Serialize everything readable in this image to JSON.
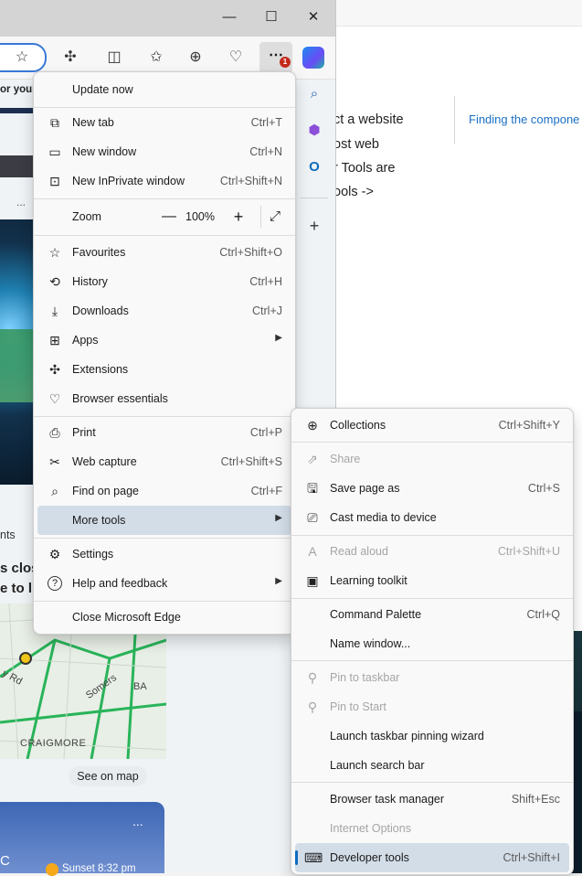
{
  "right_window": {
    "page_lines": [
      "ct a website",
      "ost web",
      "r Tools are",
      "ools ->"
    ],
    "link": "Finding the compone"
  },
  "left_window": {
    "controls": {
      "minimize": "—",
      "maximize": "☐",
      "close": "✕"
    },
    "toolbar_icons": [
      "star-icon",
      "extensions-icon",
      "split-screen-icon",
      "favorites-icon",
      "collections-icon",
      "browser-essentials-icon",
      "more-icon",
      "copilot-icon"
    ],
    "badge": "1"
  },
  "page_bg": {
    "cut_text": "or your",
    "dots": "...",
    "ents": "nts",
    "heading_lines": [
      "s clos",
      "e to l"
    ],
    "map_labels": [
      "y Rd",
      "Somers",
      "BA",
      "CRAIGMORE"
    ],
    "see_on_map": "See on map",
    "weather_temp": "C",
    "weather_more": "...",
    "sunset": "Sunset 8:32 pm"
  },
  "edge_sidebar": {
    "icons": [
      "search-icon",
      "copilot-icon",
      "outlook-icon",
      "add-icon"
    ]
  },
  "menu": {
    "update": "Update now",
    "items": [
      {
        "label": "New tab",
        "shortcut": "Ctrl+T",
        "icon": "⧉"
      },
      {
        "label": "New window",
        "shortcut": "Ctrl+N",
        "icon": "▭"
      },
      {
        "label": "New InPrivate window",
        "shortcut": "Ctrl+Shift+N",
        "icon": "⊡"
      }
    ],
    "zoom": {
      "label": "Zoom",
      "value": "100%",
      "minus": "—",
      "plus": "+",
      "full": "⤢"
    },
    "items2": [
      {
        "label": "Favourites",
        "shortcut": "Ctrl+Shift+O",
        "icon": "☆"
      },
      {
        "label": "History",
        "shortcut": "Ctrl+H",
        "icon": "⟲"
      },
      {
        "label": "Downloads",
        "shortcut": "Ctrl+J",
        "icon": "⤓"
      },
      {
        "label": "Apps",
        "shortcut": "",
        "icon": "⊞"
      },
      {
        "label": "Extensions",
        "shortcut": "",
        "icon": "✣"
      },
      {
        "label": "Browser essentials",
        "shortcut": "",
        "icon": "♡"
      }
    ],
    "items3": [
      {
        "label": "Print",
        "shortcut": "Ctrl+P",
        "icon": "⎙"
      },
      {
        "label": "Web capture",
        "shortcut": "Ctrl+Shift+S",
        "icon": "✂"
      },
      {
        "label": "Find on page",
        "shortcut": "Ctrl+F",
        "icon": "⌕"
      },
      {
        "label": "More tools",
        "shortcut": "",
        "icon": ""
      }
    ],
    "items4": [
      {
        "label": "Settings",
        "shortcut": "",
        "icon": "⚙"
      },
      {
        "label": "Help and feedback",
        "shortcut": "",
        "icon": "?"
      }
    ],
    "close": "Close Microsoft Edge"
  },
  "submenu": {
    "groups": [
      [
        {
          "label": "Collections",
          "shortcut": "Ctrl+Shift+Y",
          "icon": "⊕",
          "disabled": false
        },
        {
          "label": "Share",
          "shortcut": "",
          "icon": "⇗",
          "disabled": true
        },
        {
          "label": "Save page as",
          "shortcut": "Ctrl+S",
          "icon": "🖫",
          "disabled": false
        },
        {
          "label": "Cast media to device",
          "shortcut": "",
          "icon": "⎚",
          "disabled": false
        }
      ],
      [
        {
          "label": "Read aloud",
          "shortcut": "Ctrl+Shift+U",
          "icon": "A",
          "disabled": true
        },
        {
          "label": "Learning toolkit",
          "shortcut": "",
          "icon": "▣",
          "disabled": false
        }
      ],
      [
        {
          "label": "Command Palette",
          "shortcut": "Ctrl+Q",
          "icon": "",
          "disabled": false
        },
        {
          "label": "Name window...",
          "shortcut": "",
          "icon": "",
          "disabled": false
        }
      ],
      [
        {
          "label": "Pin to taskbar",
          "shortcut": "",
          "icon": "⚲",
          "disabled": true
        },
        {
          "label": "Pin to Start",
          "shortcut": "",
          "icon": "⚲",
          "disabled": true
        },
        {
          "label": "Launch taskbar pinning wizard",
          "shortcut": "",
          "icon": "",
          "disabled": false
        },
        {
          "label": "Launch search bar",
          "shortcut": "",
          "icon": "",
          "disabled": false
        }
      ],
      [
        {
          "label": "Browser task manager",
          "shortcut": "Shift+Esc",
          "icon": "",
          "disabled": false
        },
        {
          "label": "Internet Options",
          "shortcut": "",
          "icon": "",
          "disabled": true
        },
        {
          "label": "Developer tools",
          "shortcut": "Ctrl+Shift+I",
          "icon": "⌨",
          "disabled": false
        }
      ]
    ]
  }
}
